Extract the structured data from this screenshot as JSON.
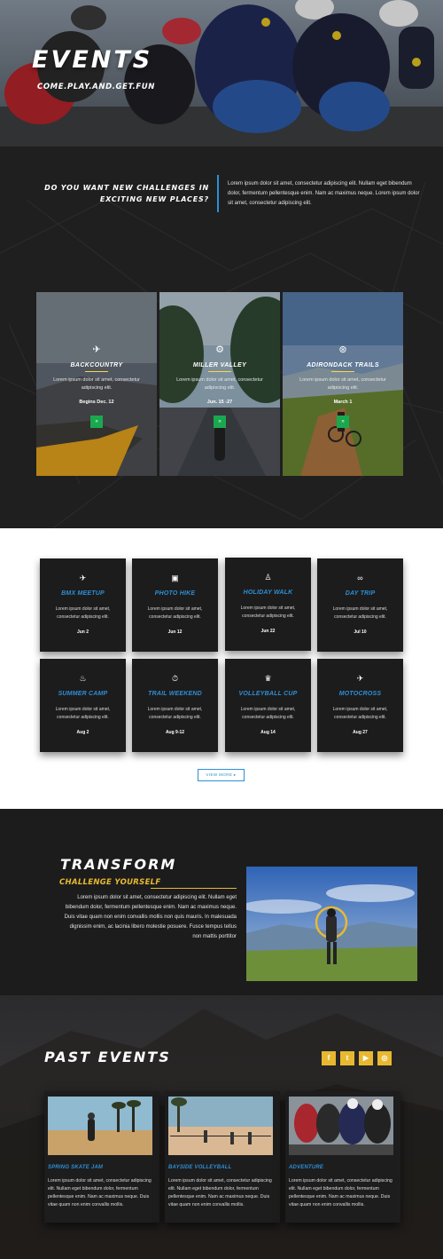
{
  "hero": {
    "title": "EVENTS",
    "subtitle": "COME.PLAY.AND.GET.FUN"
  },
  "intro": {
    "question": "DO YOU WANT NEW CHALLENGES IN EXCITING NEW PLACES?",
    "question_line1": "DO YOU WANT NEW CHALLENGES IN",
    "question_line2": "EXCITING NEW PLACES?",
    "body": "Lorem ipsum dolor sit amet, consectetur adipiscing elit. Nullam eget bibendum dolor, fermentum pellentesque enim. Nam ac maximus neque. Lorem ipsum dolor sit amet, consectetur adipiscing elit."
  },
  "featured": [
    {
      "icon": "wings-icon",
      "glyph": "✈",
      "title": "BACKCOUNTRY",
      "text": "Lorem ipsum dolor sit amet, consectetur adipiscing elit.",
      "date": "Begins Dec. 12",
      "button": "»"
    },
    {
      "icon": "gear-icon",
      "glyph": "⚙",
      "title": "MILLER VALLEY",
      "text": "Lorem ipsum dolor sit amet, consectetur adipiscing elit.",
      "date": "Jun. 15 -27",
      "button": "»"
    },
    {
      "icon": "compass-icon",
      "glyph": "⊛",
      "title": "ADIRONDACK TRAILS",
      "text": "Lorem ipsum dolor sit amet, consectetur adipiscing elit.",
      "date": "March 1",
      "button": "»"
    }
  ],
  "events": [
    {
      "icon": "wings-icon",
      "glyph": "✈",
      "title": "BMX MEETUP",
      "text": "Lorem ipsum dolor sit amet, consectetur adipiscing elit.",
      "date": "Jun 2"
    },
    {
      "icon": "camera-icon",
      "glyph": "▣",
      "title": "PHOTO HIKE",
      "text": "Lorem ipsum dolor sit amet, consectetur adipiscing elit.",
      "date": "Jun 12"
    },
    {
      "icon": "walker-icon",
      "glyph": "♙",
      "title": "HOLIDAY WALK",
      "text": "Lorem ipsum dolor sit amet, consectetur adipiscing elit.",
      "date": "Jun 22"
    },
    {
      "icon": "bicycle-icon",
      "glyph": "∞",
      "title": "DAY TRIP",
      "text": "Lorem ipsum dolor sit amet, consectetur adipiscing elit.",
      "date": "Jul 10"
    },
    {
      "icon": "flame-icon",
      "glyph": "♨",
      "title": "SUMMER CAMP",
      "text": "Lorem ipsum dolor sit amet, consectetur adipiscing elit.",
      "date": "Aug 2"
    },
    {
      "icon": "stopwatch-icon",
      "glyph": "⏱",
      "title": "TRAIL WEEKEND",
      "text": "Lorem ipsum dolor sit amet, consectetur adipiscing elit.",
      "date": "Aug 9-12"
    },
    {
      "icon": "trophy-icon",
      "glyph": "♛",
      "title": "VOLLEYBALL CUP",
      "text": "Lorem ipsum dolor sit amet, consectetur adipiscing elit.",
      "date": "Aug 14"
    },
    {
      "icon": "wings-icon",
      "glyph": "✈",
      "title": "MOTOCROSS",
      "text": "Lorem ipsum dolor sit amet, consectetur adipiscing elit.",
      "date": "Aug 27"
    }
  ],
  "view_more": "VIEW MORE ▸",
  "transform": {
    "title": "TRANSFORM",
    "subtitle": "CHALLENGE YOURSELF",
    "body": "Lorem ipsum dolor sit amet, consectetur adipiscing elit. Nullam eget bibendum dolor, fermentum pellentesque enim. Nam ac maximus neque. Duis vitae quam non enim convallis mollis non quis mauris. In malesuada dignissim enim, ac lacinia libero molestie posuere. Fusce tempus tellus non mattis porttitor"
  },
  "past": {
    "title": "PAST EVENTS",
    "social": [
      {
        "icon": "facebook-icon",
        "glyph": "f"
      },
      {
        "icon": "twitter-icon",
        "glyph": "t"
      },
      {
        "icon": "youtube-icon",
        "glyph": "▶"
      },
      {
        "icon": "instagram-icon",
        "glyph": "◎"
      }
    ],
    "cards": [
      {
        "title": "SPRING SKATE JAM",
        "text": "Lorem ipsum dolor sit amet, consectetur adipiscing elit. Nullam eget bibendum dolor, fermentum pellentesque enim. Nam ac maximus neque. Duis vitae quam non enim convallis mollis."
      },
      {
        "title": "BAYSIDE VOLLEYBALL",
        "text": "Lorem ipsum dolor sit amet, consectetur adipiscing elit. Nullam eget bibendum dolor, fermentum pellentesque enim. Nam ac maximus neque. Duis vitae quam non enim convallis mollis."
      },
      {
        "title": "ADVENTURE",
        "text": "Lorem ipsum dolor sit amet, consectetur adipiscing elit. Nullam eget bibendum dolor, fermentum pellentesque enim. Nam ac maximus neque. Duis vitae quam non enim convallis mollis."
      }
    ]
  },
  "colors": {
    "accent_blue": "#2e8fd6",
    "accent_yellow": "#e8b930",
    "accent_green": "#1aa84f",
    "dark_bg": "#1c1c1c"
  }
}
